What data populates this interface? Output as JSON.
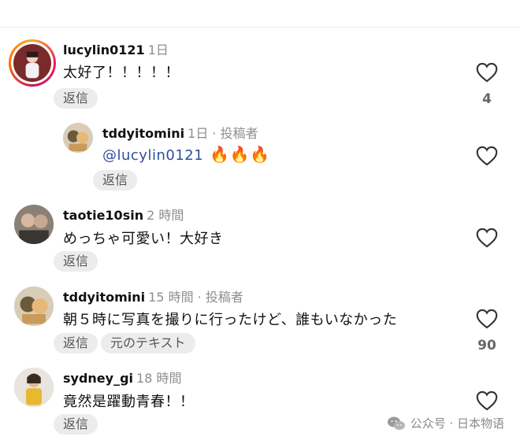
{
  "comments": [
    {
      "username": "lucylin0121",
      "time": "1日",
      "text": "太好了！！！！！",
      "reply_label": "返信",
      "likes": "4"
    },
    {
      "username": "tddyitomini",
      "time": "1日 · 投稿者",
      "mention": "@lucylin0121",
      "fire": "🔥🔥🔥",
      "reply_label": "返信"
    },
    {
      "username": "taotie10sin",
      "time": "2 時間",
      "text": "めっちゃ可愛い！大好き",
      "reply_label": "返信"
    },
    {
      "username": "tddyitomini",
      "time": "15 時間 · 投稿者",
      "text": "朝５時に写真を撮りに行ったけど、誰もいなかった",
      "reply_label": "返信",
      "translate_label": "元のテキスト",
      "likes": "90"
    },
    {
      "username": "sydney_gi",
      "time": "18 時間",
      "text": "竟然是躍動青春！！",
      "reply_label": "返信"
    }
  ],
  "watermark": {
    "label": "公众号 · 日本物语"
  },
  "colors": {
    "mention": "#2f4f9e",
    "pill_bg": "#ececec",
    "time_gray": "#8e8e8e"
  }
}
